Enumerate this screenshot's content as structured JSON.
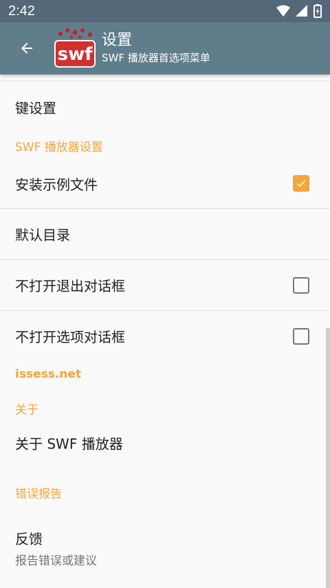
{
  "status_bar": {
    "time": "2:42",
    "icons": [
      "wifi-icon",
      "signal-icon",
      "battery-charging-icon"
    ]
  },
  "app_bar": {
    "title": "设置",
    "subtitle": "SWF 播放器首选项菜单",
    "logo_text": "swf",
    "colors": {
      "background": "#607d8b",
      "status": "#54687a"
    }
  },
  "list": {
    "key_settings": "键设置",
    "section_swf": "SWF 播放器设置",
    "install_samples": {
      "label": "安装示例文件",
      "checked": true
    },
    "default_dir": "默认目录",
    "no_exit_dialog": {
      "label": "不打开退出对话框",
      "checked": false
    },
    "no_options_dialog": {
      "label": "不打开选项对话框",
      "checked": false
    },
    "section_issess": "issess.net",
    "section_about": "关于",
    "about_swf": "关于 SWF 播放器",
    "section_bug": "错误报告",
    "feedback": {
      "label": "反馈",
      "sub": "报告错误或建议"
    }
  },
  "accent_color": "#f6a53b"
}
